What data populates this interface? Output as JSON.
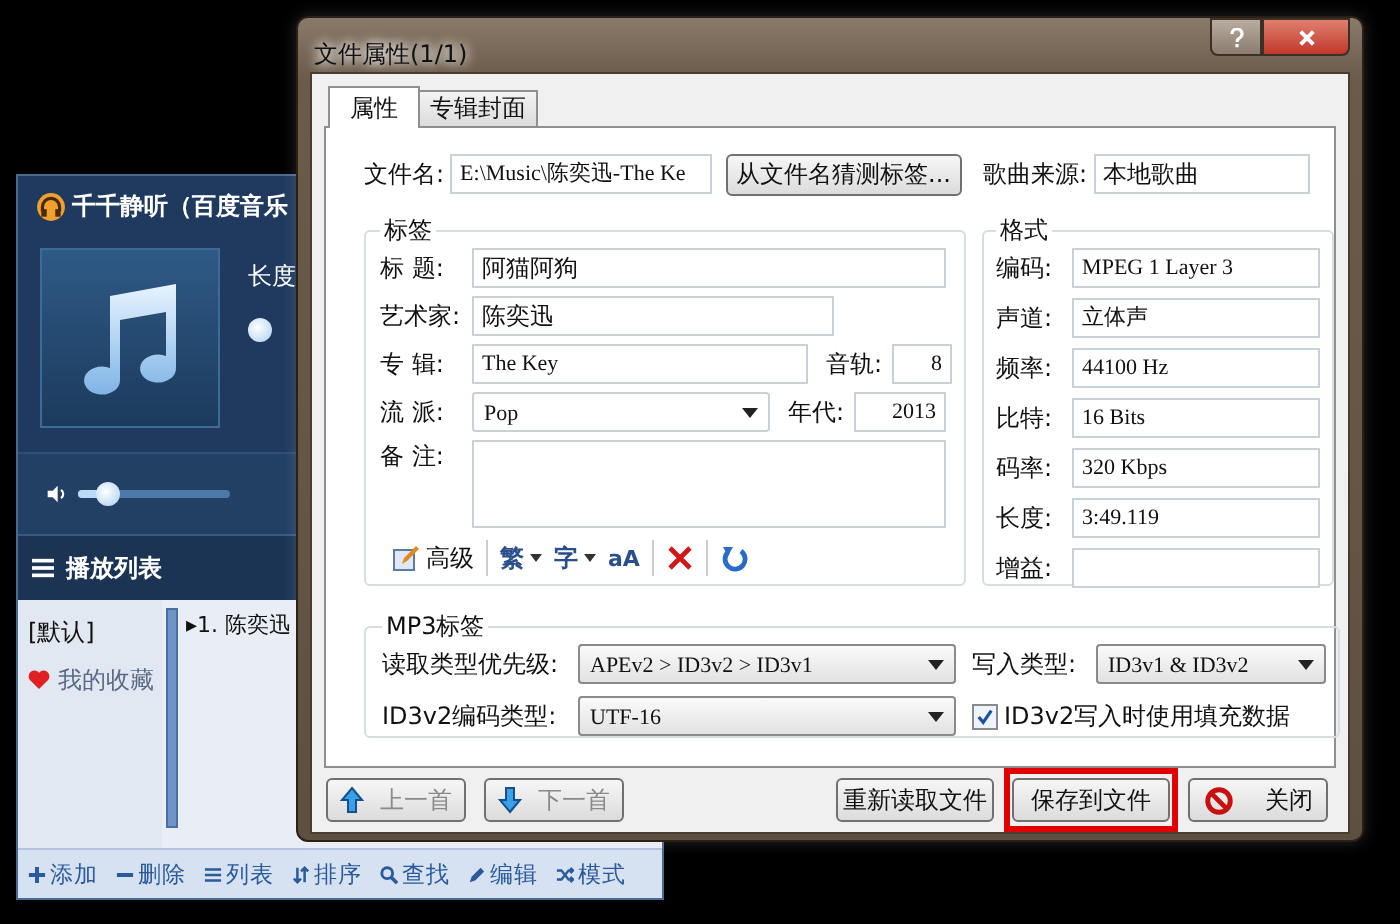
{
  "player": {
    "title": "千千静听（百度音乐",
    "length_label": "长度",
    "volume": {
      "level": 0.2
    },
    "playlist_header": "播放列表",
    "playlists": [
      {
        "label": "[默认]",
        "kind": "plain"
      },
      {
        "label": "我的收藏",
        "kind": "favorite"
      }
    ],
    "tracks": [
      {
        "label": "▸1. 陈奕迅"
      }
    ],
    "toolbar": [
      {
        "kind": "add",
        "label": "添加"
      },
      {
        "kind": "remove",
        "label": "删除"
      },
      {
        "kind": "list",
        "label": "列表"
      },
      {
        "kind": "sort",
        "label": "排序"
      },
      {
        "kind": "search",
        "label": "查找"
      },
      {
        "kind": "edit",
        "label": "编辑"
      },
      {
        "kind": "shuffle",
        "label": "模式"
      }
    ]
  },
  "dialog": {
    "title": "文件属性(1/1)",
    "tabs": [
      {
        "label": "属性",
        "selected": true
      },
      {
        "label": "专辑封面",
        "selected": false
      }
    ],
    "file_name": {
      "label": "文件名:",
      "value": "E:\\Music\\陈奕迅-The Ke"
    },
    "guess_button": "从文件名猜测标签...",
    "source": {
      "label": "歌曲来源:",
      "value": "本地歌曲"
    },
    "tag_group": {
      "title": "标签",
      "title_field": {
        "label": "标 题:",
        "value": "阿猫阿狗"
      },
      "artist": {
        "label": "艺术家:",
        "value": "陈奕迅"
      },
      "album": {
        "label": "专 辑:",
        "value": "The Key"
      },
      "track": {
        "label": "音轨:",
        "value": "8"
      },
      "genre": {
        "label": "流 派:",
        "value": "Pop"
      },
      "year": {
        "label": "年代:",
        "value": "2013"
      },
      "comment": {
        "label": "备 注:"
      },
      "tools": [
        {
          "kind": "advanced",
          "label": "高级"
        },
        {
          "kind": "dropdown",
          "label": "繁"
        },
        {
          "kind": "dropdown",
          "label": "字"
        },
        {
          "kind": "text",
          "label": "aA"
        },
        {
          "kind": "delete"
        },
        {
          "kind": "refresh"
        }
      ]
    },
    "format_group": {
      "title": "格式",
      "fields": [
        {
          "label": "编码:",
          "value": "MPEG 1 Layer 3"
        },
        {
          "label": "声道:",
          "value": "立体声"
        },
        {
          "label": "频率:",
          "value": "44100 Hz"
        },
        {
          "label": "比特:",
          "value": "16 Bits"
        },
        {
          "label": "码率:",
          "value": "320 Kbps"
        },
        {
          "label": "长度:",
          "value": "3:49.119"
        },
        {
          "label": "增益:"
        }
      ]
    },
    "mp3_group": {
      "title": "MP3标签",
      "read_priority": {
        "label": "读取类型优先级:",
        "value": "APEv2 > ID3v2 > ID3v1"
      },
      "write_type": {
        "label": "写入类型:",
        "value": "ID3v1 & ID3v2"
      },
      "encoding": {
        "label": "ID3v2编码类型:",
        "value": "UTF-16"
      },
      "padding": {
        "label": "ID3v2写入时使用填充数据",
        "checked": true
      }
    },
    "nav_buttons": [
      {
        "kind": "up",
        "label": "上一首",
        "disabled": true
      },
      {
        "kind": "down",
        "label": "下一首",
        "disabled": true
      }
    ],
    "action_buttons": [
      {
        "kind": "plain",
        "label": "重新读取文件",
        "highlighted": false
      },
      {
        "kind": "plain",
        "label": "保存到文件",
        "highlighted": true
      },
      {
        "kind": "close",
        "label": "关闭",
        "highlighted": false
      }
    ]
  }
}
